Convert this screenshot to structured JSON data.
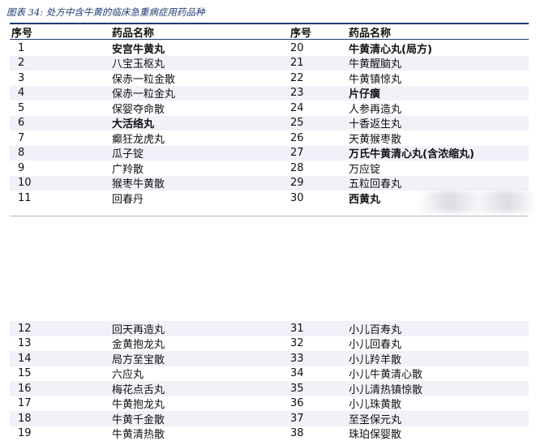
{
  "caption": "图表 34: 处方中含牛黄的临床急重病症用药品种",
  "headers": {
    "no": "序号",
    "name": "药品名称"
  },
  "rows_top": [
    {
      "a_no": "1",
      "a_name": "安宫牛黄丸",
      "a_bold": true,
      "b_no": "20",
      "b_name": "牛黄清心丸(局方)",
      "b_bold": true
    },
    {
      "a_no": "2",
      "a_name": "八宝玉枢丸",
      "a_bold": false,
      "b_no": "21",
      "b_name": "牛黄醒脑丸",
      "b_bold": false
    },
    {
      "a_no": "3",
      "a_name": "保赤一粒金散",
      "a_bold": false,
      "b_no": "22",
      "b_name": "牛黄镇惊丸",
      "b_bold": false
    },
    {
      "a_no": "4",
      "a_name": "保赤一粒金丸",
      "a_bold": false,
      "b_no": "23",
      "b_name": "片仔癀",
      "b_bold": true
    },
    {
      "a_no": "5",
      "a_name": "保婴夺命散",
      "a_bold": false,
      "b_no": "24",
      "b_name": "人参再造丸",
      "b_bold": false
    },
    {
      "a_no": "6",
      "a_name": "大活络丸",
      "a_bold": true,
      "b_no": "25",
      "b_name": "十香返生丸",
      "b_bold": false
    },
    {
      "a_no": "7",
      "a_name": "癫狂龙虎丸",
      "a_bold": false,
      "b_no": "26",
      "b_name": "天黄猴枣散",
      "b_bold": false
    },
    {
      "a_no": "8",
      "a_name": "瓜子锭",
      "a_bold": false,
      "b_no": "27",
      "b_name": "万氏牛黄清心丸(含浓缩丸)",
      "b_bold": true
    },
    {
      "a_no": "9",
      "a_name": "广羚散",
      "a_bold": false,
      "b_no": "28",
      "b_name": "万应锭",
      "b_bold": false
    },
    {
      "a_no": "10",
      "a_name": "猴枣牛黄散",
      "a_bold": false,
      "b_no": "29",
      "b_name": "五粒回春丸",
      "b_bold": false
    },
    {
      "a_no": "11",
      "a_name": "回春丹",
      "a_bold": false,
      "b_no": "30",
      "b_name": "西黄丸",
      "b_bold": true
    }
  ],
  "rows_bottom": [
    {
      "a_no": "12",
      "a_name": "回天再造丸",
      "b_no": "31",
      "b_name": "小儿百寿丸"
    },
    {
      "a_no": "13",
      "a_name": "金黄抱龙丸",
      "b_no": "32",
      "b_name": "小儿回春丸"
    },
    {
      "a_no": "14",
      "a_name": "局方至宝散",
      "b_no": "33",
      "b_name": "小儿羚羊散"
    },
    {
      "a_no": "15",
      "a_name": "六应丸",
      "b_no": "34",
      "b_name": "小儿牛黄清心散"
    },
    {
      "a_no": "16",
      "a_name": "梅花点舌丸",
      "b_no": "35",
      "b_name": "小儿清热镇惊散"
    },
    {
      "a_no": "17",
      "a_name": "牛黄抱龙丸",
      "b_no": "36",
      "b_name": "小儿珠黄散"
    },
    {
      "a_no": "18",
      "a_name": "牛黄千金散",
      "b_no": "37",
      "b_name": "至圣保元丸"
    },
    {
      "a_no": "19",
      "a_name": "牛黄清热散",
      "b_no": "38",
      "b_name": "珠珀保婴散"
    }
  ]
}
